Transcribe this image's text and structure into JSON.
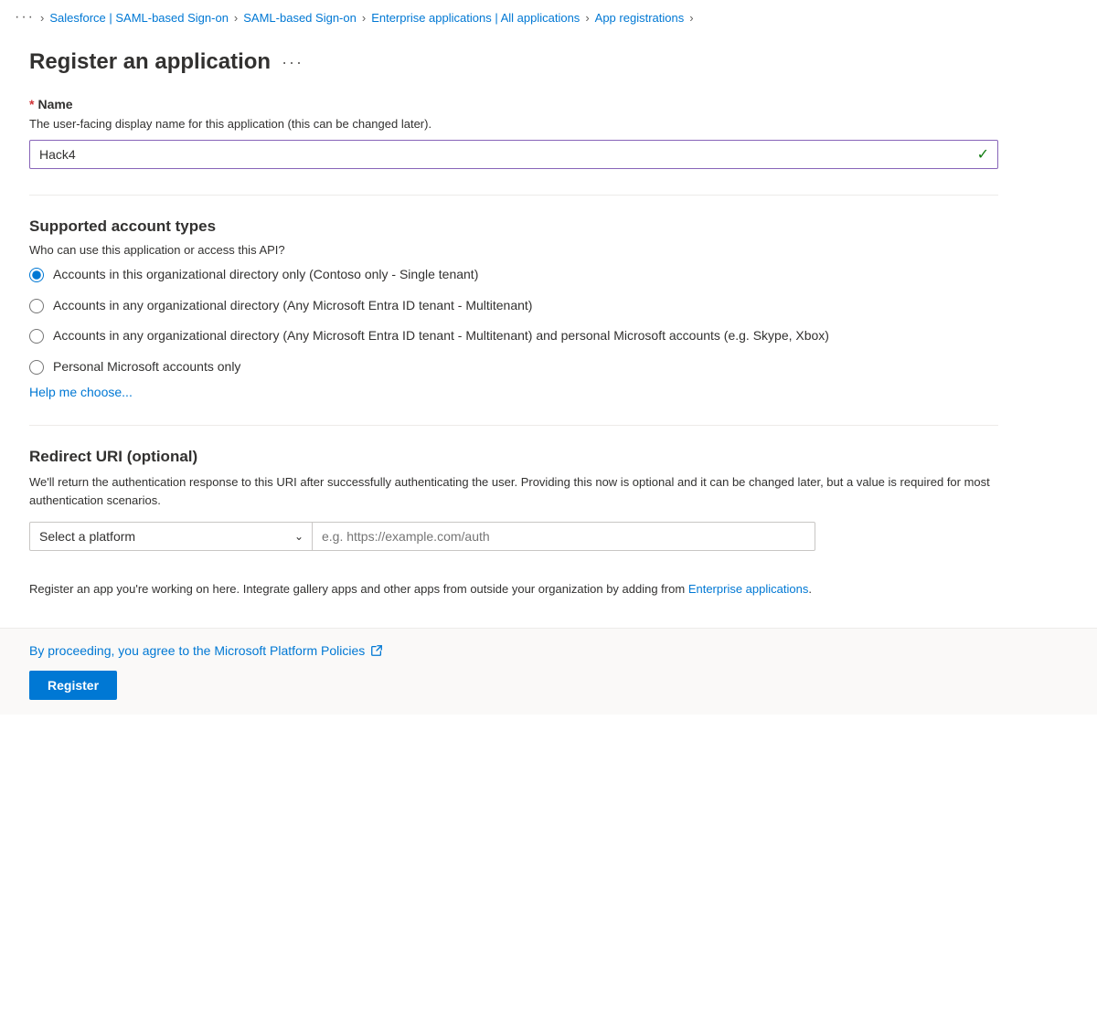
{
  "breadcrumb": {
    "dots": "···",
    "items": [
      {
        "label": "Salesforce | SAML-based Sign-on",
        "id": "bc-salesforce"
      },
      {
        "label": "SAML-based Sign-on",
        "id": "bc-saml"
      },
      {
        "label": "Enterprise applications | All applications",
        "id": "bc-enterprise"
      },
      {
        "label": "App registrations",
        "id": "bc-appregistrations"
      }
    ]
  },
  "page": {
    "title": "Register an application",
    "title_dots": "···"
  },
  "name_field": {
    "label": "Name",
    "required": true,
    "description": "The user-facing display name for this application (this can be changed later).",
    "value": "Hack4"
  },
  "account_types": {
    "heading": "Supported account types",
    "question": "Who can use this application or access this API?",
    "options": [
      {
        "id": "opt1",
        "label": "Accounts in this organizational directory only (Contoso only - Single tenant)",
        "checked": true
      },
      {
        "id": "opt2",
        "label": "Accounts in any organizational directory (Any Microsoft Entra ID tenant - Multitenant)",
        "checked": false
      },
      {
        "id": "opt3",
        "label": "Accounts in any organizational directory (Any Microsoft Entra ID tenant - Multitenant) and personal Microsoft accounts (e.g. Skype, Xbox)",
        "checked": false
      },
      {
        "id": "opt4",
        "label": "Personal Microsoft accounts only",
        "checked": false
      }
    ],
    "help_link": "Help me choose..."
  },
  "redirect_uri": {
    "heading": "Redirect URI (optional)",
    "description": "We'll return the authentication response to this URI after successfully authenticating the user. Providing this now is optional and it can be changed later, but a value is required for most authentication scenarios.",
    "platform_placeholder": "Select a platform",
    "uri_placeholder": "e.g. https://example.com/auth"
  },
  "info_text": {
    "text_before": "Register an app you're working on here. Integrate gallery apps and other apps from outside your organization by adding from",
    "link_label": "Enterprise applications",
    "text_after": "."
  },
  "footer": {
    "policy_text": "By proceeding, you agree to the Microsoft Platform Policies",
    "register_button": "Register"
  }
}
